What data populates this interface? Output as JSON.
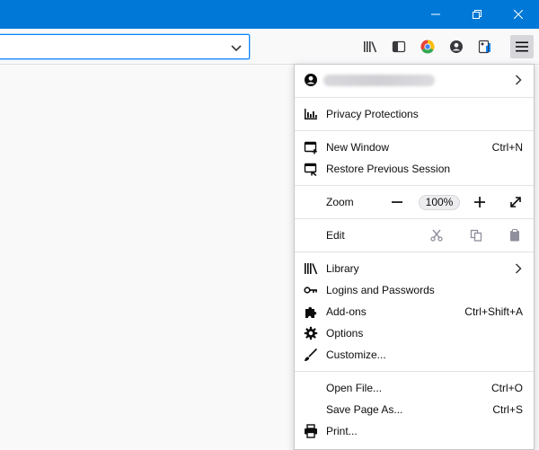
{
  "menu": {
    "account": {
      "email_obscured": ""
    },
    "privacy": "Privacy Protections",
    "new_window": {
      "label": "New Window",
      "shortcut": "Ctrl+N"
    },
    "restore": "Restore Previous Session",
    "zoom": {
      "label": "Zoom",
      "level": "100%"
    },
    "edit": "Edit",
    "library": "Library",
    "logins": "Logins and Passwords",
    "addons": {
      "label": "Add-ons",
      "shortcut": "Ctrl+Shift+A"
    },
    "options": "Options",
    "customize": "Customize...",
    "open_file": {
      "label": "Open File...",
      "shortcut": "Ctrl+O"
    },
    "save_page": {
      "label": "Save Page As...",
      "shortcut": "Ctrl+S"
    },
    "print": "Print..."
  },
  "icons": {
    "window_controls": [
      "minimize-icon",
      "restore-icon",
      "close-icon"
    ],
    "toolbar": [
      "library-icon",
      "sidebar-icon",
      "chrome-icon",
      "account-icon",
      "extension-icon",
      "hamburger-menu-icon"
    ]
  },
  "colors": {
    "titlebar": "#0078d7",
    "url_focus": "#0a84ff",
    "extension_accent": "#0a84ff",
    "zoom_reset_bg": "#ededf0"
  }
}
